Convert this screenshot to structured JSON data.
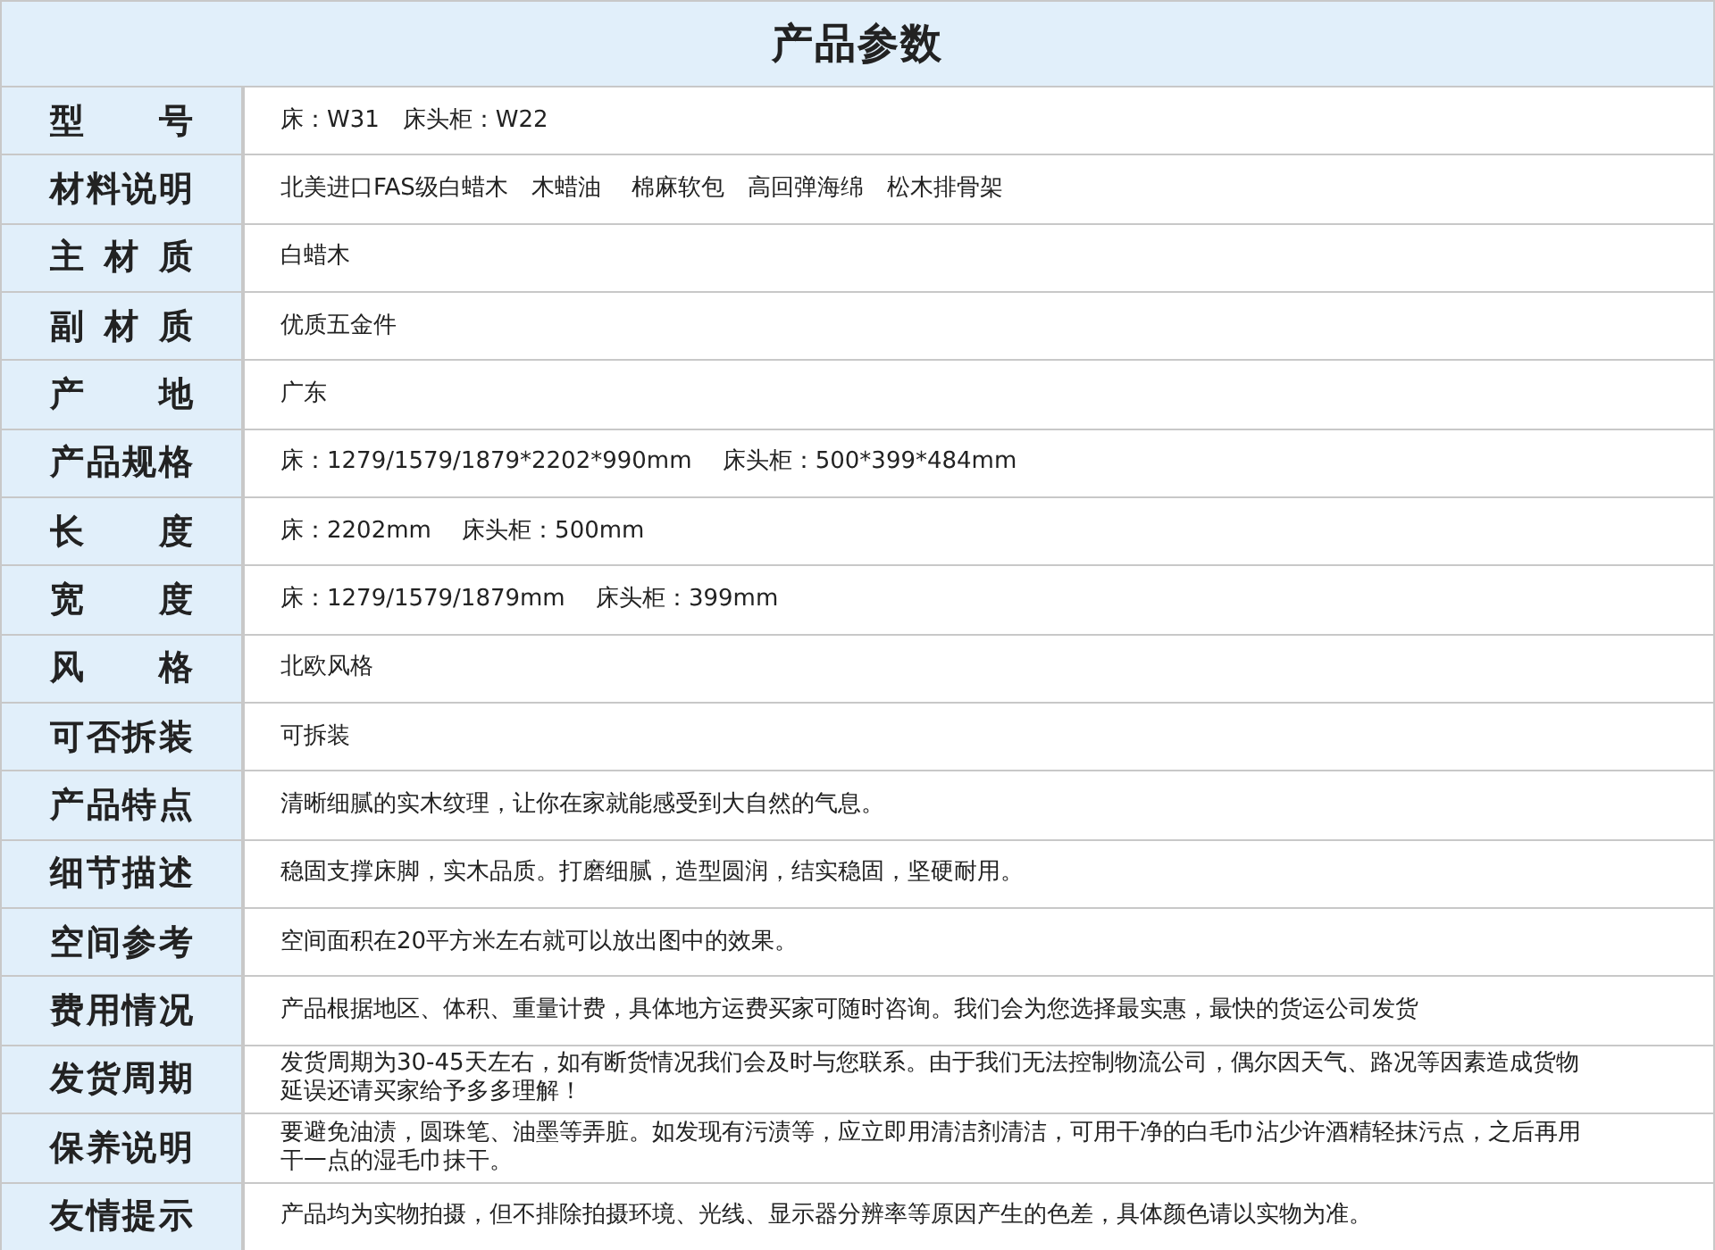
{
  "title": "产品参数",
  "rows": [
    {
      "label": "型 号",
      "value": "床：W31　床头柜：W22"
    },
    {
      "label": "材料说明",
      "value": "北美进口FAS级白蜡木　木蜡油　 棉麻软包　高回弹海绵　松木排骨架"
    },
    {
      "label": "主 材 质",
      "value": "白蜡木"
    },
    {
      "label": "副 材 质",
      "value": "优质五金件"
    },
    {
      "label": "产 地",
      "value": "广东"
    },
    {
      "label": "产品规格",
      "value": "床：1279/1579/1879*2202*990mm　 床头柜：500*399*484mm"
    },
    {
      "label": "长 度",
      "value": "床：2202mm　 床头柜：500mm"
    },
    {
      "label": "宽 度",
      "value": "床：1279/1579/1879mm　 床头柜：399mm"
    },
    {
      "label": "风 格",
      "value": "北欧风格"
    },
    {
      "label": "可否拆装",
      "value": "可拆装"
    },
    {
      "label": "产品特点",
      "value": "清晰细腻的实木纹理，让你在家就能感受到大自然的气息。"
    },
    {
      "label": "细节描述",
      "value": "稳固支撑床脚，实木品质。打磨细腻，造型圆润，结实稳固，坚硬耐用。"
    },
    {
      "label": "空间参考",
      "value": "空间面积在20平方米左右就可以放出图中的效果。"
    },
    {
      "label": "费用情况",
      "value": "产品根据地区、体积、重量计费，具体地方运费买家可随时咨询。我们会为您选择最实惠，最快的货运公司发货"
    },
    {
      "label": "发货周期",
      "value": "发货周期为30-45天左右，如有断货情况我们会及时与您联系。由于我们无法控制物流公司，偶尔因天气、路况等因素造成货物延误还请买家给予多多理解！"
    },
    {
      "label": "保养说明",
      "value": "要避免油渍，圆珠笔、油墨等弄脏。如发现有污渍等，应立即用清洁剂清洁，可用干净的白毛巾沾少许酒精轻抹污点，之后再用干一点的湿毛巾抹干。"
    },
    {
      "label": "友情提示",
      "value": "产品均为实物拍摄，但不排除拍摄环境、光线、显示器分辨率等原因产生的色差，具体颜色请以实物为准。"
    }
  ]
}
